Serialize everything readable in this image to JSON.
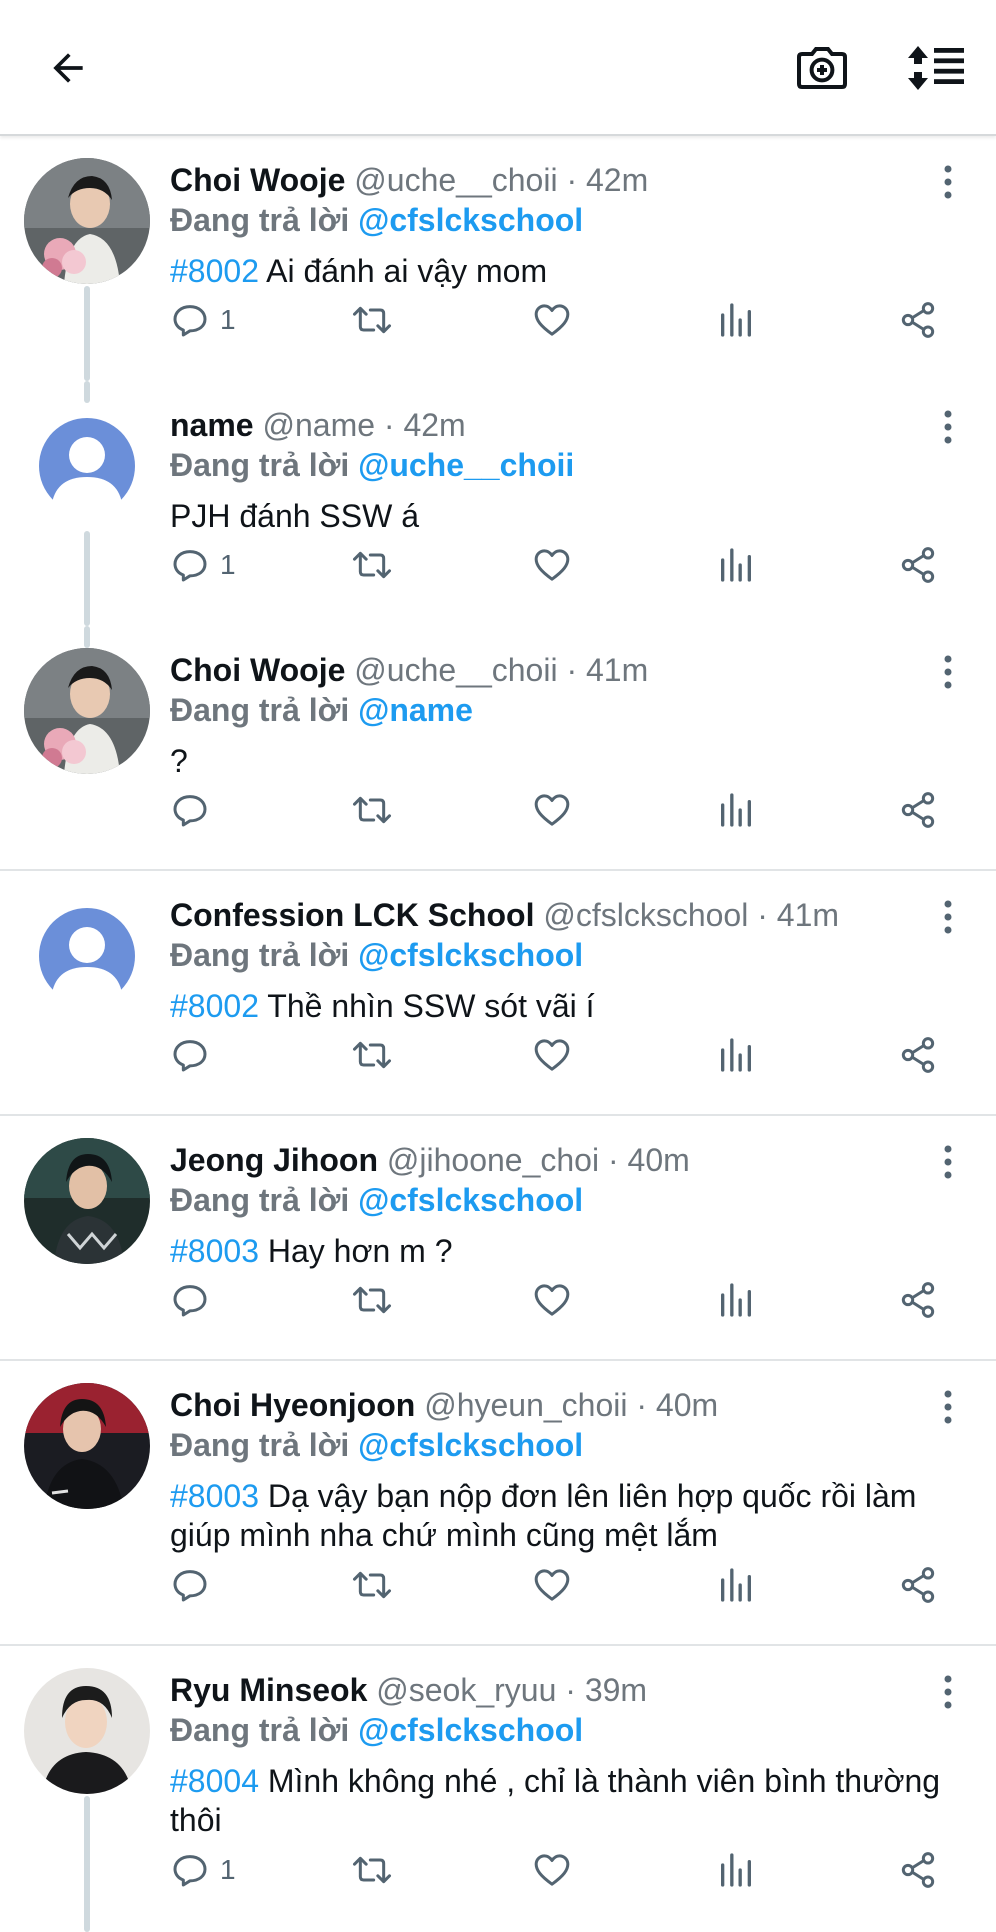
{
  "header": {
    "back_icon": "arrow-left-icon",
    "camera_icon": "camera-plus-icon",
    "sort_icon": "sort-lines-icon"
  },
  "colors": {
    "accent": "#1d9bf0",
    "muted": "#6e767d",
    "divider": "#e1e4e6"
  },
  "reply_prefix": "Đang trả lời",
  "tweets": [
    {
      "name": "Choi Wooje",
      "handle": "@uche__choii",
      "time": "· 42m",
      "reply_to": "@cfslckschool",
      "hashtag": "#8002",
      "text": "Ai đánh ai vậy mom",
      "reply_count": "1"
    },
    {
      "name": "name",
      "handle": "@name",
      "time": "· 42m",
      "reply_to": "@uche__choii",
      "hashtag": "",
      "text": "PJH đánh SSW á",
      "reply_count": "1"
    },
    {
      "name": "Choi Wooje",
      "handle": "@uche__choii",
      "time": "· 41m",
      "reply_to": "@name",
      "hashtag": "",
      "text": "?",
      "reply_count": ""
    },
    {
      "name": "Confession LCK School",
      "handle": "@cfslckschool",
      "time": "· 41m",
      "reply_to": "@cfslckschool",
      "hashtag": "#8002",
      "text": "Thề nhìn SSW sót vãi í",
      "reply_count": ""
    },
    {
      "name": "Jeong Jihoon",
      "handle": "@jihoone_choi",
      "time": "· 40m",
      "reply_to": "@cfslckschool",
      "hashtag": "#8003",
      "text": "Hay hơn m ?",
      "reply_count": ""
    },
    {
      "name": "Choi Hyeonjoon",
      "handle": "@hyeun_choii",
      "time": "· 40m",
      "reply_to": "@cfslckschool",
      "hashtag": "#8003",
      "text": "Dạ vậy bạn nộp đơn lên liên hợp quốc rồi làm giúp mình nha chứ mình cũng mệt lắm",
      "reply_count": ""
    },
    {
      "name": "Ryu Minseok",
      "handle": "@seok_ryuu",
      "time": "· 39m",
      "reply_to": "@cfslckschool",
      "hashtag": "#8004",
      "text": "Mình không nhé , chỉ là thành viên bình thường thôi",
      "reply_count": "1"
    }
  ]
}
